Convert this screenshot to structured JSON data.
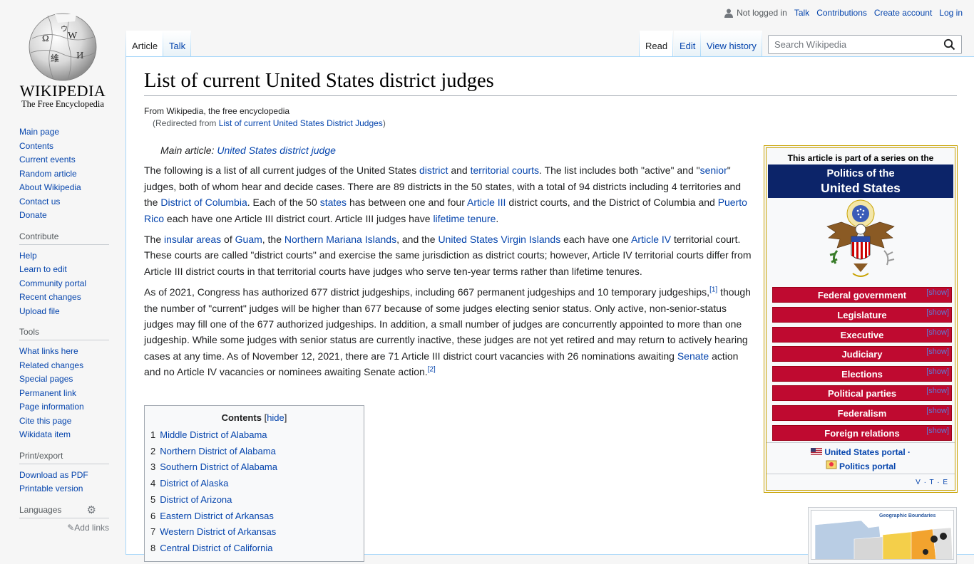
{
  "logo": {
    "wordmark": "WIKIPEDIA",
    "tagline": "The Free Encyclopedia"
  },
  "personal": {
    "not_logged_in": "Not logged in",
    "links": [
      "Talk",
      "Contributions",
      "Create account",
      "Log in"
    ]
  },
  "sidebar": {
    "navigation": [
      "Main page",
      "Contents",
      "Current events",
      "Random article",
      "About Wikipedia",
      "Contact us",
      "Donate"
    ],
    "contribute": {
      "heading": "Contribute",
      "items": [
        "Help",
        "Learn to edit",
        "Community portal",
        "Recent changes",
        "Upload file"
      ]
    },
    "tools": {
      "heading": "Tools",
      "items": [
        "What links here",
        "Related changes",
        "Special pages",
        "Permanent link",
        "Page information",
        "Cite this page",
        "Wikidata item"
      ]
    },
    "print": {
      "heading": "Print/export",
      "items": [
        "Download as PDF",
        "Printable version"
      ]
    },
    "languages": {
      "heading": "Languages",
      "add_links": "Add links"
    }
  },
  "tabs": {
    "article": "Article",
    "talk": "Talk",
    "read": "Read",
    "edit": "Edit",
    "history": "View history"
  },
  "search": {
    "placeholder": "Search Wikipedia"
  },
  "page": {
    "title": "List of current United States district judges",
    "tagline": "From Wikipedia, the free encyclopedia",
    "redirect_prefix": "(Redirected from ",
    "redirect_link": "List of current United States District Judges",
    "redirect_suffix": ")",
    "hatnote_prefix": "Main article: ",
    "hatnote_link": "United States district judge"
  },
  "paragraphs": [
    [
      {
        "t": "The following is a list of all current judges of the United States "
      },
      {
        "t": "district",
        "link": true
      },
      {
        "t": " and "
      },
      {
        "t": "territorial courts",
        "link": true
      },
      {
        "t": ". The list includes both \"active\" and \""
      },
      {
        "t": "senior",
        "link": true
      },
      {
        "t": "\" judges, both of whom hear and decide cases. There are 89 districts in the 50 states, with a total of 94 districts including 4 territories and the "
      },
      {
        "t": "District of Columbia",
        "link": true
      },
      {
        "t": ". Each of the 50 "
      },
      {
        "t": "states",
        "link": true
      },
      {
        "t": " has between one and four "
      },
      {
        "t": "Article III",
        "link": true
      },
      {
        "t": " district courts, and the District of Columbia and "
      },
      {
        "t": "Puerto Rico",
        "link": true
      },
      {
        "t": " each have one Article III district court. Article III judges have "
      },
      {
        "t": "lifetime tenure",
        "link": true
      },
      {
        "t": "."
      }
    ],
    [
      {
        "t": "The "
      },
      {
        "t": "insular areas",
        "link": true
      },
      {
        "t": " of "
      },
      {
        "t": "Guam",
        "link": true
      },
      {
        "t": ", the "
      },
      {
        "t": "Northern Mariana Islands",
        "link": true
      },
      {
        "t": ", and the "
      },
      {
        "t": "United States Virgin Islands",
        "link": true
      },
      {
        "t": " each have one "
      },
      {
        "t": "Article IV",
        "link": true
      },
      {
        "t": " territorial court. These courts are called \"district courts\" and exercise the same jurisdiction as district courts; however, Article IV territorial courts differ from Article III district courts in that territorial courts have judges who serve ten-year terms rather than lifetime tenures."
      }
    ],
    [
      {
        "t": "As of 2021, Congress has authorized 677 district judgeships, including 667 permanent judgeships and 10 temporary judgeships,"
      },
      {
        "t": "[1]",
        "link": true,
        "sup": true
      },
      {
        "t": " though the number of \"current\" judges will be higher than 677 because of some judges electing senior status. Only active, non-senior-status judges may fill one of the 677 authorized judgeships. In addition, a small number of judges are concurrently appointed to more than one judgeship. While some judges with senior status are currently inactive, these judges are not yet retired and may return to actively hearing cases at any time. As of November 12, 2021, there are 71 Article III district court vacancies with 26 nominations awaiting "
      },
      {
        "t": "Senate",
        "link": true
      },
      {
        "t": " action and no Article IV vacancies or nominees awaiting Senate action."
      },
      {
        "t": "[2]",
        "link": true,
        "sup": true
      }
    ]
  ],
  "toc": {
    "title": "Contents",
    "hide_label": "hide",
    "items": [
      {
        "num": "1",
        "label": "Middle District of Alabama"
      },
      {
        "num": "2",
        "label": "Northern District of Alabama"
      },
      {
        "num": "3",
        "label": "Southern District of Alabama"
      },
      {
        "num": "4",
        "label": "District of Alaska"
      },
      {
        "num": "5",
        "label": "District of Arizona"
      },
      {
        "num": "6",
        "label": "Eastern District of Arkansas"
      },
      {
        "num": "7",
        "label": "Western District of Arkansas"
      },
      {
        "num": "8",
        "label": "Central District of California"
      }
    ]
  },
  "series_box": {
    "pretitle": "This article is part of a series on the",
    "title_line1": "Politics of the",
    "title_line2": "United States",
    "sections": [
      "Federal government",
      "Legislature",
      "Executive",
      "Judiciary",
      "Elections",
      "Political parties",
      "Federalism",
      "Foreign relations"
    ],
    "show_label": "[show]",
    "portal_us": "United States portal ·",
    "portal_politics": "Politics portal",
    "vte": "V · T · E",
    "colors": {
      "header": "#0c2469",
      "section": "#bf0a30",
      "border": "#c8a200"
    }
  },
  "map_thumb": {
    "title": "Geographic Boundaries"
  }
}
